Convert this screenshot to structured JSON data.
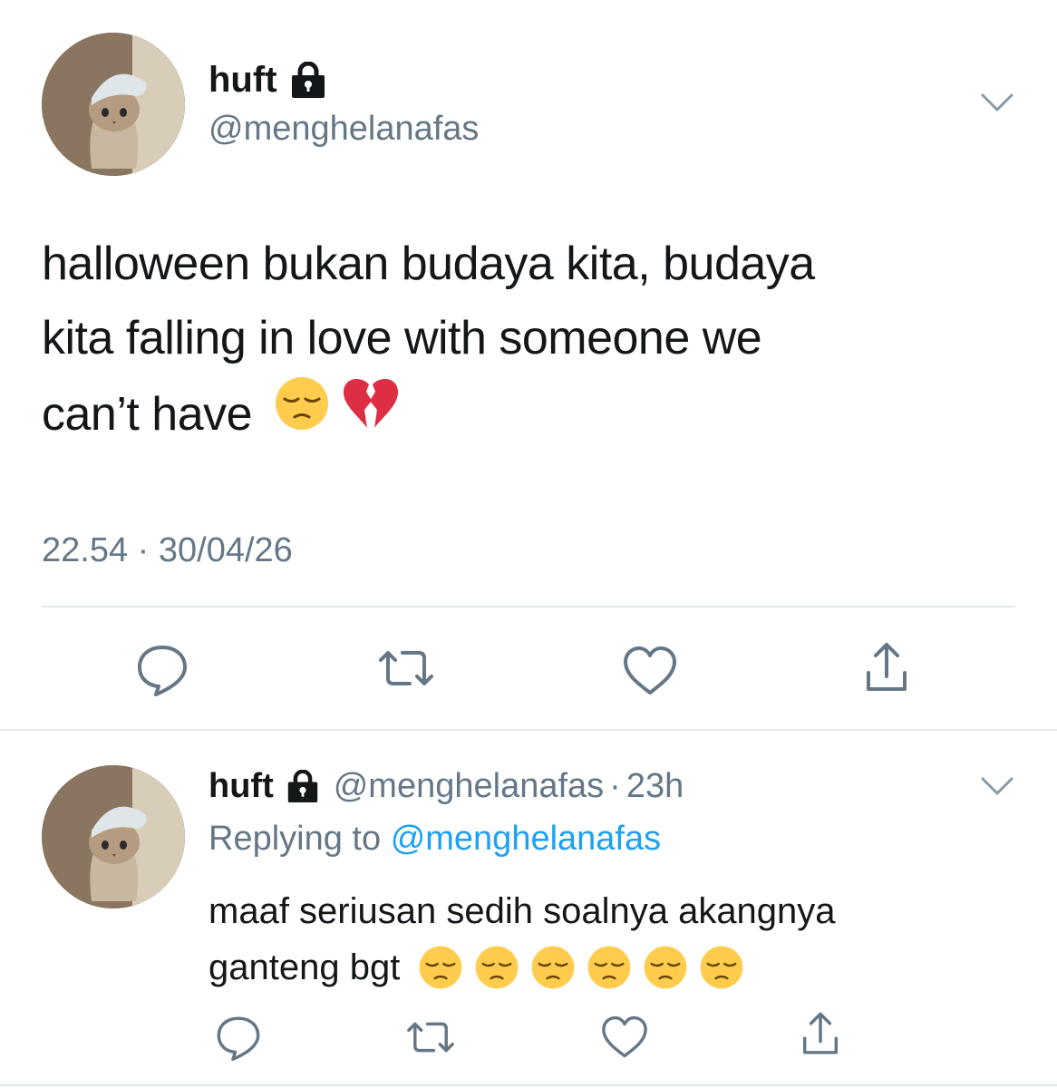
{
  "main_tweet": {
    "display_name": "huft",
    "handle": "@menghelanafas",
    "text_line1": "halloween bukan budaya kita, budaya",
    "text_line2": "kita falling in love with someone we",
    "text_line3": "can’t have",
    "emojis": [
      "pensive-face",
      "broken-heart"
    ],
    "timestamp": "22.54 · 30/04/26",
    "protected_icon": "lock-icon"
  },
  "reply_tweet": {
    "display_name": "huft",
    "handle": "@menghelanafas",
    "separator": "·",
    "time_ago": "23h",
    "replying_prefix": "Replying to",
    "replying_handle": "@menghelanafas",
    "text_line1": "maaf seriusan sedih soalnya akangnya",
    "text_line2": "ganteng bgt",
    "emojis": [
      "pensive-face",
      "pensive-face",
      "pensive-face",
      "pensive-face",
      "pensive-face",
      "pensive-face"
    ]
  },
  "actions": [
    "reply-icon",
    "retweet-icon",
    "like-icon",
    "share-icon"
  ],
  "colors": {
    "text": "#14171a",
    "secondary": "#657786",
    "link": "#1da1f2",
    "divider": "#e1e8ed"
  }
}
